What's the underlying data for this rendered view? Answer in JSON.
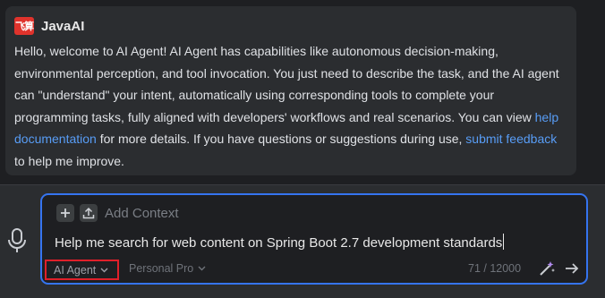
{
  "agent": {
    "logo_text": "飞算",
    "name": "JavaAI"
  },
  "message": {
    "text_1": "Hello, welcome to AI Agent! AI Agent has capabilities like autonomous decision-making, environmental perception, and tool invocation. You just need to describe the task, and the AI agent can \"understand\" your intent, automatically using corresponding tools to complete your programming tasks, fully aligned with developers' workflows and real scenarios. You can view ",
    "link_help": "help documentation",
    "text_2": " for more details. If you have questions or suggestions during use, ",
    "link_feedback": "submit feedback",
    "text_3": " to help me improve."
  },
  "input": {
    "add_context_label": "Add Context",
    "query": "Help me search for web content on Spring Boot 2.7 development standards",
    "mode": "AI Agent",
    "model": "Personal Pro",
    "counter": "71 / 12000"
  },
  "colors": {
    "accent": "#3574f0",
    "link": "#589df6",
    "highlight": "#e0202a",
    "logo": "#e0332c"
  },
  "icons": [
    "plus-icon",
    "upload-icon",
    "microphone-icon",
    "chevron-down-icon",
    "magic-wand-icon",
    "send-arrow-icon"
  ]
}
